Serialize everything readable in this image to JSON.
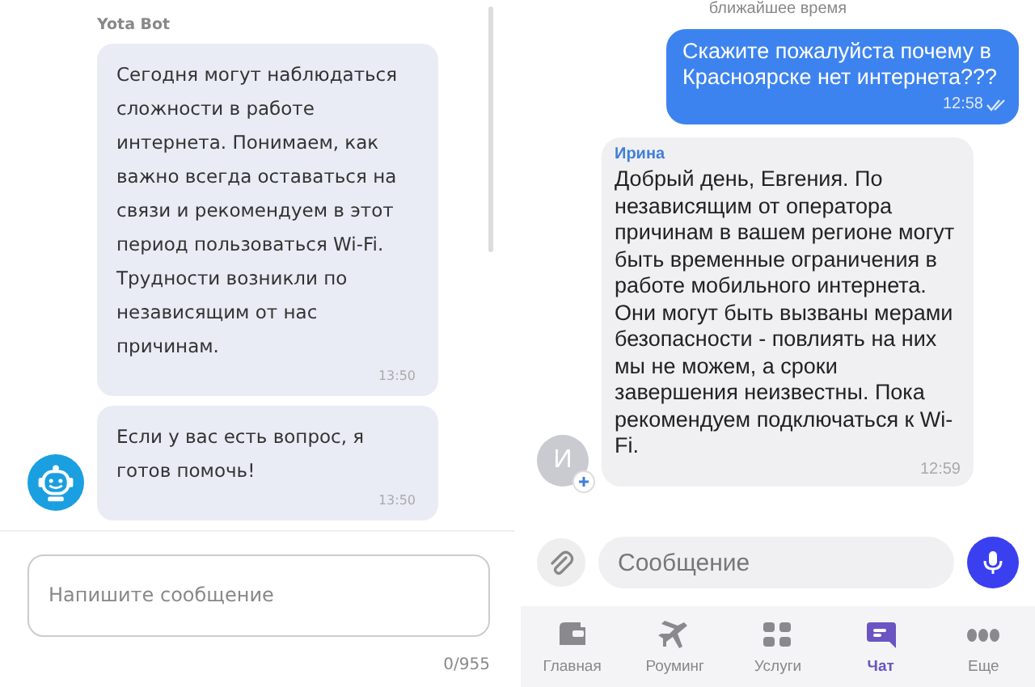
{
  "bot_chat": {
    "sender": "Yota Bot",
    "messages": [
      {
        "text": "Сегодня могут наблюдаться сложности в работе интернета. Понимаем, как важно всегда оставаться на связи и рекомендуем в этот период пользоваться Wi-Fi. Трудности возникли по независящим от нас причинам.",
        "time": "13:50"
      },
      {
        "text": "Если у вас есть вопрос, я готов помочь!",
        "time": "13:50"
      }
    ],
    "input": {
      "placeholder": "Напишите сообщение"
    },
    "counter": "0/955"
  },
  "operator_chat": {
    "notice": "ближайшее время",
    "messages": [
      {
        "kind": "outgoing",
        "text": "Скажите пожалуйста почему в Красноярске нет интернета???",
        "time": "12:58",
        "read": true
      },
      {
        "kind": "incoming",
        "sender": "Ирина",
        "avatar": "И",
        "text": "Добрый день, Евгения. По независящим от оператора причинам в вашем регионе могут быть временные ограничения в работе мобильного интернета. Они могут быть вызваны мерами безопасности - повлиять на них мы не можем, а сроки завершения неизвестны. Пока рекомендуем подключаться к Wi-Fi.",
        "time": "12:59"
      }
    ],
    "input": {
      "placeholder": "Сообщение"
    },
    "tabs": [
      {
        "label": "Главная",
        "selected": false
      },
      {
        "label": "Роуминг",
        "selected": false
      },
      {
        "label": "Услуги",
        "selected": false
      },
      {
        "label": "Чат",
        "selected": true
      },
      {
        "label": "Еще",
        "selected": false
      }
    ]
  }
}
